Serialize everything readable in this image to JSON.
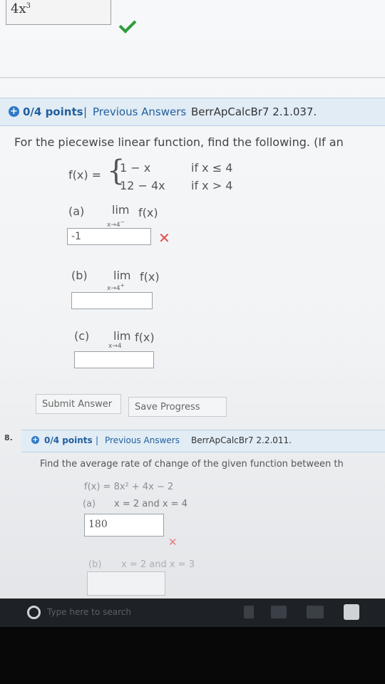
{
  "prev_question": {
    "answer": "4x",
    "answer_exp": "3",
    "status_icon": "check-icon"
  },
  "q7": {
    "header": {
      "points": "0/4 points",
      "separator": "|",
      "prev_link": "Previous Answers",
      "code": "BerrApCalcBr7 2.1.037."
    },
    "prompt": "For the piecewise linear function, find the following. (If an",
    "func": {
      "label": "f(x) =",
      "piece1_expr": "1 − x",
      "piece1_cond": "if x ≤ 4",
      "piece2_expr": "12 − 4x",
      "piece2_cond": "if x > 4"
    },
    "parts": [
      {
        "label": "(a)",
        "lim": "lim",
        "func": "f(x)",
        "sub": "x→4",
        "sup": "−",
        "value": "-1",
        "status_icon": "x-icon"
      },
      {
        "label": "(b)",
        "lim": "lim",
        "func": "f(x)",
        "sub": "x→4",
        "sup": "+",
        "value": ""
      },
      {
        "label": "(c)",
        "lim": "lim",
        "func": "f(x)",
        "sub": "x→4",
        "sup": "",
        "value": ""
      }
    ],
    "buttons": {
      "submit": "Submit Answer",
      "save": "Save Progress"
    }
  },
  "q8": {
    "number": "8.",
    "header": {
      "points": "0/4 points",
      "separator": "|",
      "prev_link": "Previous Answers",
      "code": "BerrApCalcBr7 2.2.011."
    },
    "prompt": "Find the average rate of change of the given function between th",
    "func": "f(x) = 8x² + 4x − 2",
    "part_a": {
      "label": "(a)",
      "condition": "x = 2 and x = 4",
      "value": "180",
      "status_icon": "x-icon"
    },
    "part_b": {
      "label": "(b)",
      "condition": "x = 2 and x = 3"
    }
  },
  "taskbar": {
    "search_hint": "Type here to search"
  },
  "colors": {
    "header_bg": "#e1ecf5",
    "link": "#225f9e",
    "error": "#e74b4b",
    "success": "#2e9c3a"
  }
}
